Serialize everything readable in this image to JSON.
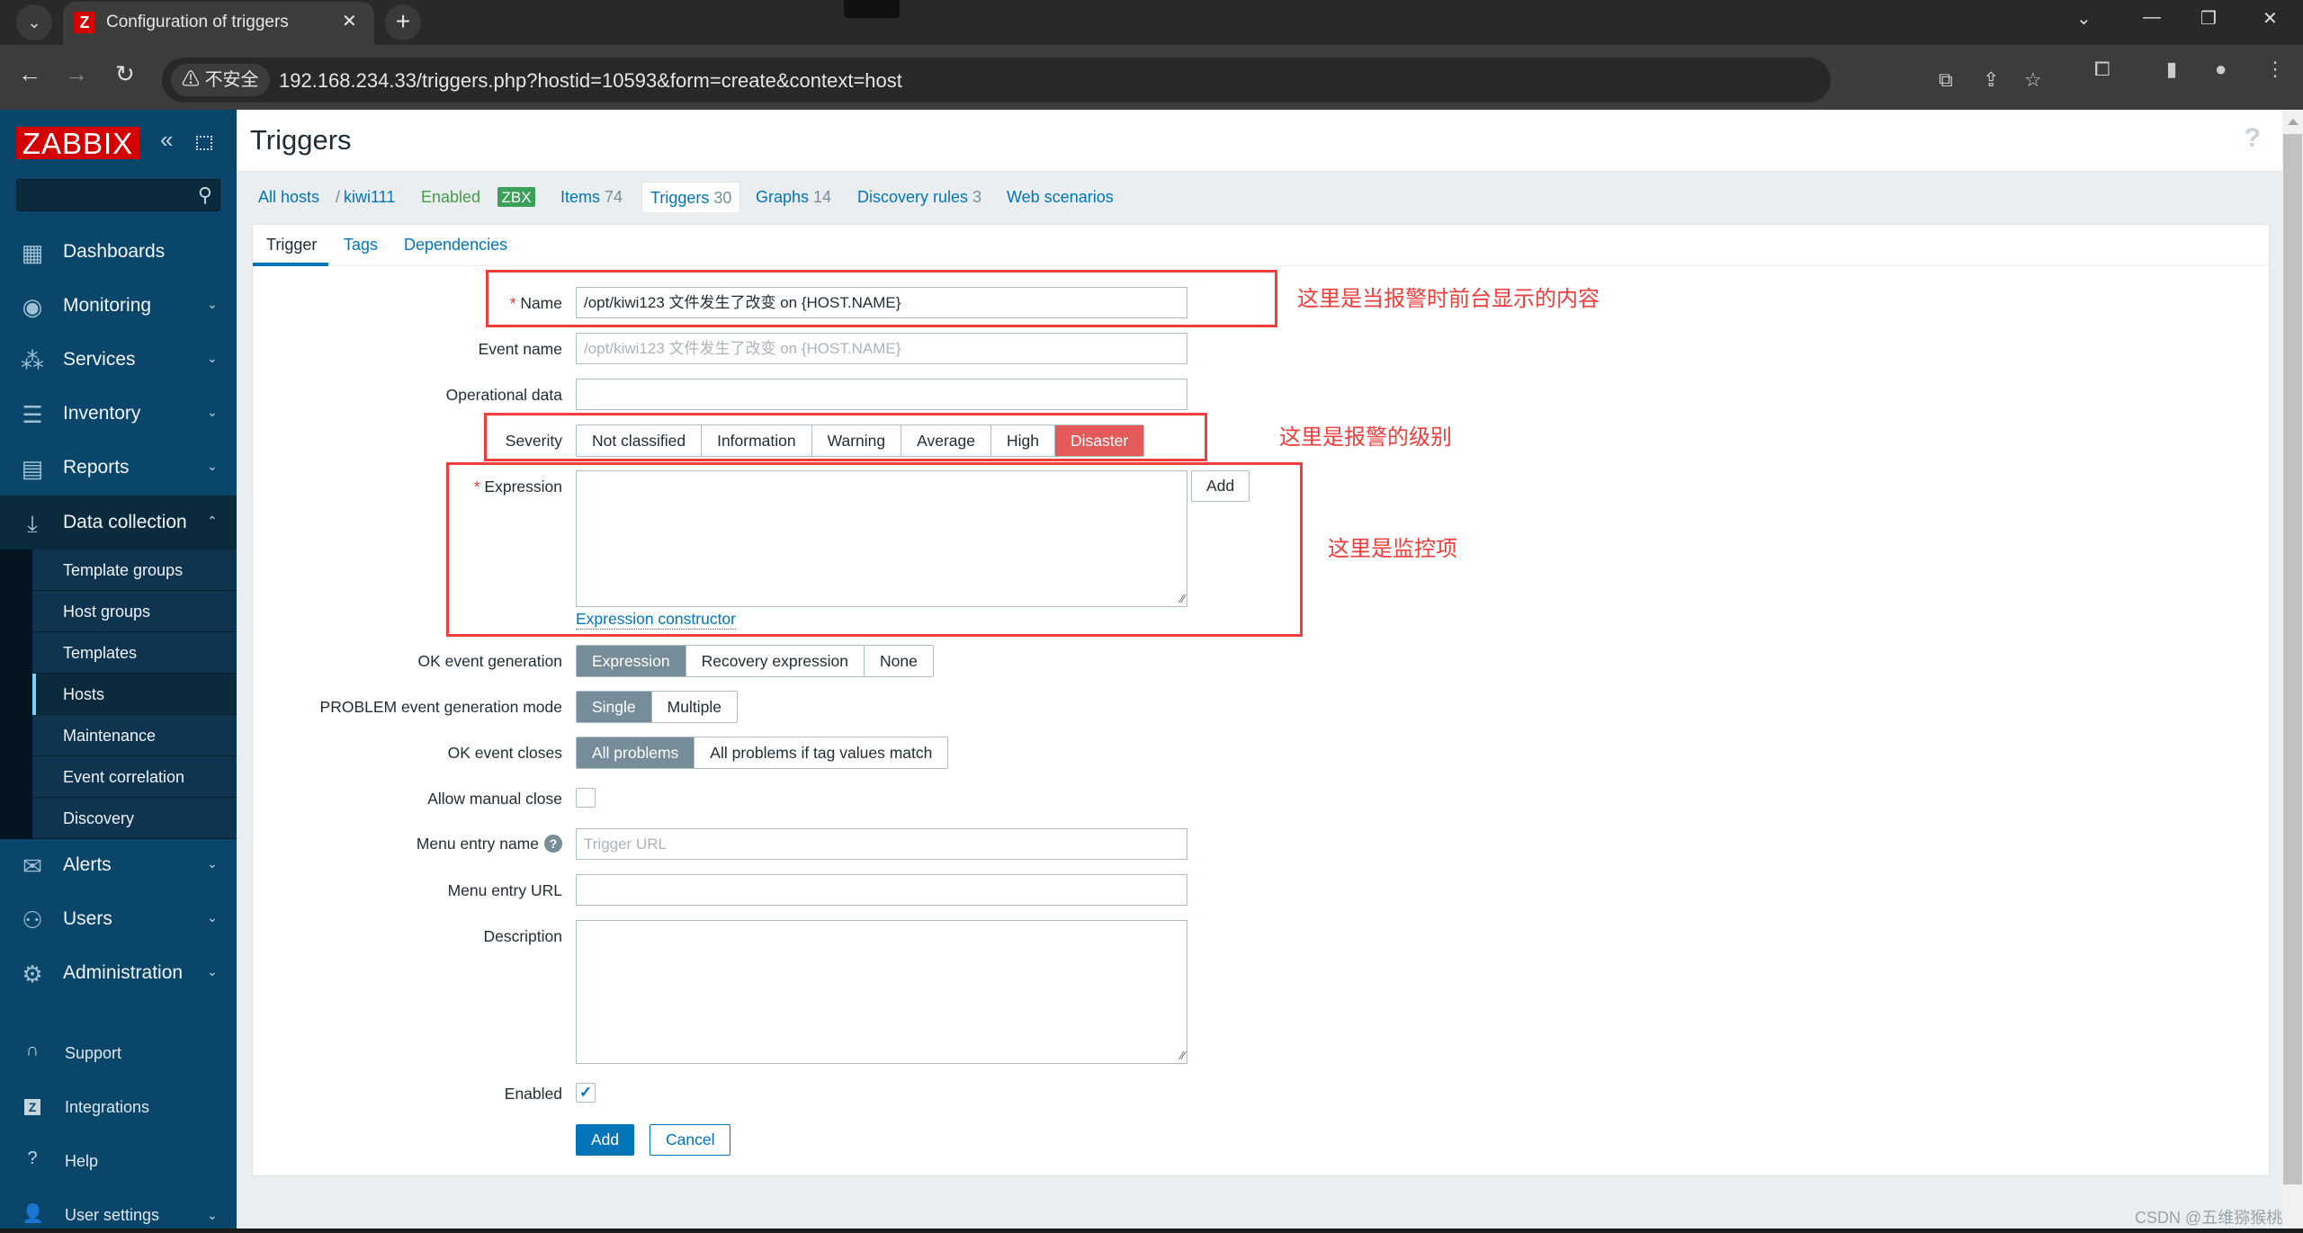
{
  "browser": {
    "tab_title": "Configuration of triggers",
    "favicon_letter": "Z",
    "security_label": "不安全",
    "url": "192.168.234.33/triggers.php?hostid=10593&form=create&context=host"
  },
  "sidebar": {
    "logo": "ZABBIX",
    "search_placeholder": "",
    "menu": [
      {
        "label": "Dashboards",
        "icon": "dashboard-icon"
      },
      {
        "label": "Monitoring",
        "icon": "eye-icon"
      },
      {
        "label": "Services",
        "icon": "hierarchy-icon"
      },
      {
        "label": "Inventory",
        "icon": "list-icon"
      },
      {
        "label": "Reports",
        "icon": "report-icon"
      },
      {
        "label": "Data collection",
        "icon": "download-icon"
      },
      {
        "label": "Alerts",
        "icon": "envelope-icon"
      },
      {
        "label": "Users",
        "icon": "users-icon"
      },
      {
        "label": "Administration",
        "icon": "gear-icon"
      }
    ],
    "submenu": [
      {
        "label": "Template groups"
      },
      {
        "label": "Host groups"
      },
      {
        "label": "Templates"
      },
      {
        "label": "Hosts"
      },
      {
        "label": "Maintenance"
      },
      {
        "label": "Event correlation"
      },
      {
        "label": "Discovery"
      }
    ],
    "active_submenu": "Hosts",
    "utility": [
      {
        "label": "Support",
        "icon": "headset-icon"
      },
      {
        "label": "Integrations",
        "icon": "zabbix-z-icon"
      },
      {
        "label": "Help",
        "icon": "question-icon"
      },
      {
        "label": "User settings",
        "icon": "user-icon"
      }
    ]
  },
  "page": {
    "title": "Triggers",
    "help": "?"
  },
  "host_nav": {
    "all_hosts": "All hosts",
    "separator": "/",
    "host": "kiwi111",
    "status": "Enabled",
    "badge": "ZBX",
    "items_label": "Items",
    "items_count": "74",
    "triggers_label": "Triggers",
    "triggers_count": "30",
    "graphs_label": "Graphs",
    "graphs_count": "14",
    "discovery_label": "Discovery rules",
    "discovery_count": "3",
    "web_label": "Web scenarios"
  },
  "form_tabs": [
    "Trigger",
    "Tags",
    "Dependencies"
  ],
  "form": {
    "name_label": "Name",
    "name_value": "/opt/kiwi123  文件发生了改变 on {HOST.NAME}",
    "event_name_label": "Event name",
    "event_name_value": "/opt/kiwi123  文件发生了改变 on {HOST.NAME}",
    "operational_data_label": "Operational data",
    "operational_data_value": "",
    "severity_label": "Severity",
    "severity_options": [
      "Not classified",
      "Information",
      "Warning",
      "Average",
      "High",
      "Disaster"
    ],
    "severity_selected": "Disaster",
    "expression_label": "Expression",
    "expression_value": "",
    "expression_add": "Add",
    "expression_constructor": "Expression constructor",
    "ok_event_generation_label": "OK event generation",
    "ok_event_generation_options": [
      "Expression",
      "Recovery expression",
      "None"
    ],
    "ok_event_generation_selected": "Expression",
    "problem_mode_label": "PROBLEM event generation mode",
    "problem_mode_options": [
      "Single",
      "Multiple"
    ],
    "problem_mode_selected": "Single",
    "ok_event_closes_label": "OK event closes",
    "ok_event_closes_options": [
      "All problems",
      "All problems if tag values match"
    ],
    "ok_event_closes_selected": "All problems",
    "allow_manual_close_label": "Allow manual close",
    "allow_manual_close_checked": false,
    "menu_entry_name_label": "Menu entry name",
    "menu_entry_name_placeholder": "Trigger URL",
    "menu_entry_url_label": "Menu entry URL",
    "menu_entry_url_value": "",
    "description_label": "Description",
    "description_value": "",
    "enabled_label": "Enabled",
    "enabled_checked": true,
    "check_mark": "✓",
    "add_button": "Add",
    "cancel_button": "Cancel"
  },
  "annotations": {
    "name_note": "这里是当报警时前台显示的内容",
    "severity_note": "这里是报警的级别",
    "expression_note": "这里是监控项",
    "color": "#f23d3d"
  },
  "watermark": "CSDN @五维猕猴桃",
  "colors": {
    "sidebar_bg": "#0a466a",
    "link": "#0275b8",
    "disaster": "#e45959",
    "selected_segment": "#768d99",
    "enabled_green": "#429e47",
    "logo_red": "#d40000"
  }
}
